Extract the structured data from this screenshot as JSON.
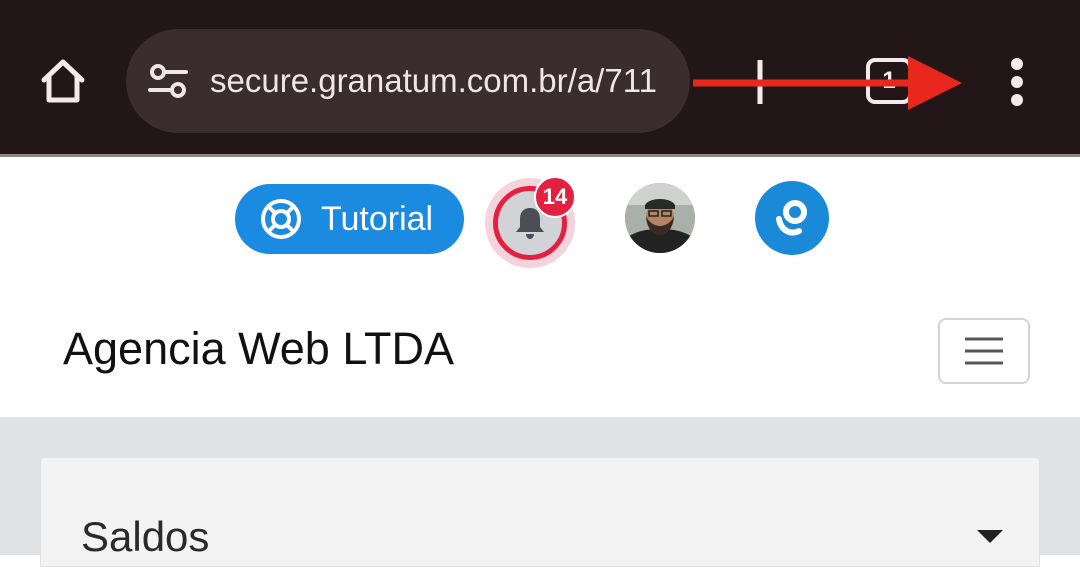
{
  "browser": {
    "url": "secure.granatum.com.br/a/711",
    "tab_count": "1",
    "icons": {
      "home": "home-icon",
      "site_settings": "tune-icon",
      "new_tab": "plus-icon",
      "tabs": "tabs-icon",
      "menu": "more-vert-icon"
    },
    "annotation_arrow_color": "#e8281c"
  },
  "app": {
    "tutorial_label": "Tutorial",
    "notifications_count": "14",
    "company_name": "Agencia Web LTDA",
    "colors": {
      "primary": "#1a8be0",
      "danger": "#e3203f"
    }
  },
  "main": {
    "card_title": "Saldos"
  }
}
